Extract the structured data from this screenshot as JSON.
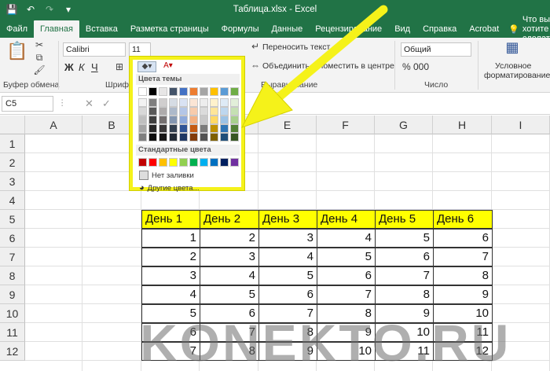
{
  "window": {
    "title": "Таблица.xlsx  -  Excel"
  },
  "tabs": [
    {
      "label": "Файл",
      "active": false
    },
    {
      "label": "Главная",
      "active": true
    },
    {
      "label": "Вставка",
      "active": false
    },
    {
      "label": "Разметка страницы",
      "active": false
    },
    {
      "label": "Формулы",
      "active": false
    },
    {
      "label": "Данные",
      "active": false
    },
    {
      "label": "Рецензирование",
      "active": false
    },
    {
      "label": "Вид",
      "active": false
    },
    {
      "label": "Справка",
      "active": false
    },
    {
      "label": "Acrobat",
      "active": false
    }
  ],
  "tell_me": "Что вы хотите сделать?",
  "ribbon": {
    "clipboard_label": "Буфер обмена",
    "font_label": "Шрифт",
    "font_name": "Calibri",
    "font_size": "11",
    "align_label": "Выравнивание",
    "wrap_text": "Переносить текст",
    "merge_center": "Объединить и поместить в центре",
    "number_label": "Число",
    "number_format": "Общий",
    "cond_format_1": "Условное",
    "cond_format_2": "форматирование"
  },
  "formula_bar": {
    "name_box": "C5"
  },
  "columns": [
    "A",
    "B",
    "C",
    "D",
    "E",
    "F",
    "G",
    "H",
    "I"
  ],
  "rows": [
    "1",
    "2",
    "3",
    "4",
    "5",
    "6",
    "7",
    "8",
    "9",
    "10",
    "11",
    "12"
  ],
  "table": {
    "headers": [
      "День 1",
      "День 2",
      "День 3",
      "День 4",
      "День 5",
      "День 6"
    ],
    "rows": [
      [
        "1",
        "2",
        "3",
        "4",
        "5",
        "6"
      ],
      [
        "2",
        "3",
        "4",
        "5",
        "6",
        "7"
      ],
      [
        "3",
        "4",
        "5",
        "6",
        "7",
        "8"
      ],
      [
        "4",
        "5",
        "6",
        "7",
        "8",
        "9"
      ],
      [
        "5",
        "6",
        "7",
        "8",
        "9",
        "10"
      ],
      [
        "6",
        "7",
        "8",
        "9",
        "10",
        "11"
      ],
      [
        "7",
        "8",
        "9",
        "10",
        "11",
        "12"
      ]
    ]
  },
  "fill_menu": {
    "theme_colors_label": "Цвета темы",
    "standard_colors_label": "Стандартные цвета",
    "no_fill": "Нет заливки",
    "more_colors": "Другие цвета...",
    "theme_top": [
      "#ffffff",
      "#000000",
      "#e7e6e6",
      "#44546a",
      "#4472c4",
      "#ed7d31",
      "#a5a5a5",
      "#ffc000",
      "#5b9bd5",
      "#70ad47"
    ],
    "theme_shades": [
      [
        "#f2f2f2",
        "#7f7f7f",
        "#d0cece",
        "#d6dce4",
        "#d9e2f3",
        "#fbe5d5",
        "#ededed",
        "#fff2cc",
        "#deebf6",
        "#e2efd9"
      ],
      [
        "#d8d8d8",
        "#595959",
        "#aeabab",
        "#adb9ca",
        "#b4c6e7",
        "#f7cbac",
        "#dbdbdb",
        "#fee599",
        "#bdd7ee",
        "#c5e0b3"
      ],
      [
        "#bfbfbf",
        "#3f3f3f",
        "#757070",
        "#8496b0",
        "#8eaadb",
        "#f4b183",
        "#c9c9c9",
        "#ffd965",
        "#9cc3e5",
        "#a8d08d"
      ],
      [
        "#a5a5a5",
        "#262626",
        "#3a3838",
        "#323f4f",
        "#2f5496",
        "#c55a11",
        "#7b7b7b",
        "#bf9000",
        "#2e75b5",
        "#538135"
      ],
      [
        "#7f7f7f",
        "#0c0c0c",
        "#171616",
        "#222a35",
        "#1f3864",
        "#833c0b",
        "#525252",
        "#7f6000",
        "#1e4e79",
        "#375623"
      ]
    ],
    "standard": [
      "#c00000",
      "#ff0000",
      "#ffc000",
      "#ffff00",
      "#92d050",
      "#00b050",
      "#00b0f0",
      "#0070c0",
      "#002060",
      "#7030a0"
    ]
  },
  "watermark": "KONEKTO.RU"
}
